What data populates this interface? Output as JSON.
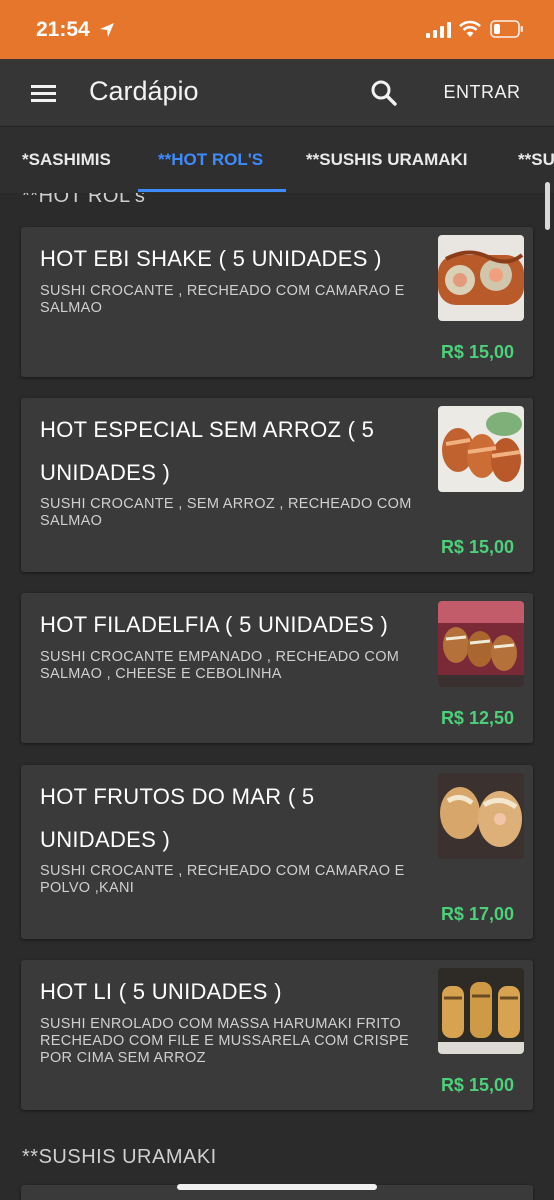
{
  "status_bar": {
    "time": "21:54"
  },
  "app_bar": {
    "title": "Cardápio",
    "login_label": "ENTRAR"
  },
  "tabs": [
    {
      "label": "*SASHIMIS"
    },
    {
      "label": "**HOT ROL'S"
    },
    {
      "label": "**SUSHIS URAMAKI"
    },
    {
      "label": "**SU"
    }
  ],
  "sections": [
    {
      "title": "**HOT ROL's"
    },
    {
      "title": "**SUSHIS URAMAKI"
    }
  ],
  "items": [
    {
      "name": "HOT EBI SHAKE ( 5 UNIDADES )",
      "description": "SUSHI CROCANTE , RECHEADO COM CAMARAO E SALMAO",
      "price": "R$ 15,00"
    },
    {
      "name": "HOT ESPECIAL SEM ARROZ ( 5 UNIDADES )",
      "description": "SUSHI CROCANTE , SEM ARROZ , RECHEADO COM SALMAO",
      "price": "R$ 15,00"
    },
    {
      "name": "HOT FILADELFIA ( 5 UNIDADES )",
      "description": "SUSHI CROCANTE EMPANADO , RECHEADO COM SALMAO , CHEESE E CEBOLINHA",
      "price": "R$ 12,50"
    },
    {
      "name": "HOT FRUTOS DO MAR ( 5 UNIDADES )",
      "description": "SUSHI CROCANTE , RECHEADO COM CAMARAO E POLVO ,KANI",
      "price": "R$ 17,00"
    },
    {
      "name": "HOT LI ( 5 UNIDADES )",
      "description": "SUSHI ENROLADO COM MASSA HARUMAKI FRITO RECHEADO COM FILE E MUSSARELA COM CRISPE POR CIMA SEM ARROZ",
      "price": "R$ 15,00"
    }
  ],
  "colors": {
    "status_bar": "#e5762c",
    "app_bar": "#363636",
    "active_tab": "#3d8bfd",
    "price": "#4cd07a",
    "card": "#3a3a3a"
  }
}
